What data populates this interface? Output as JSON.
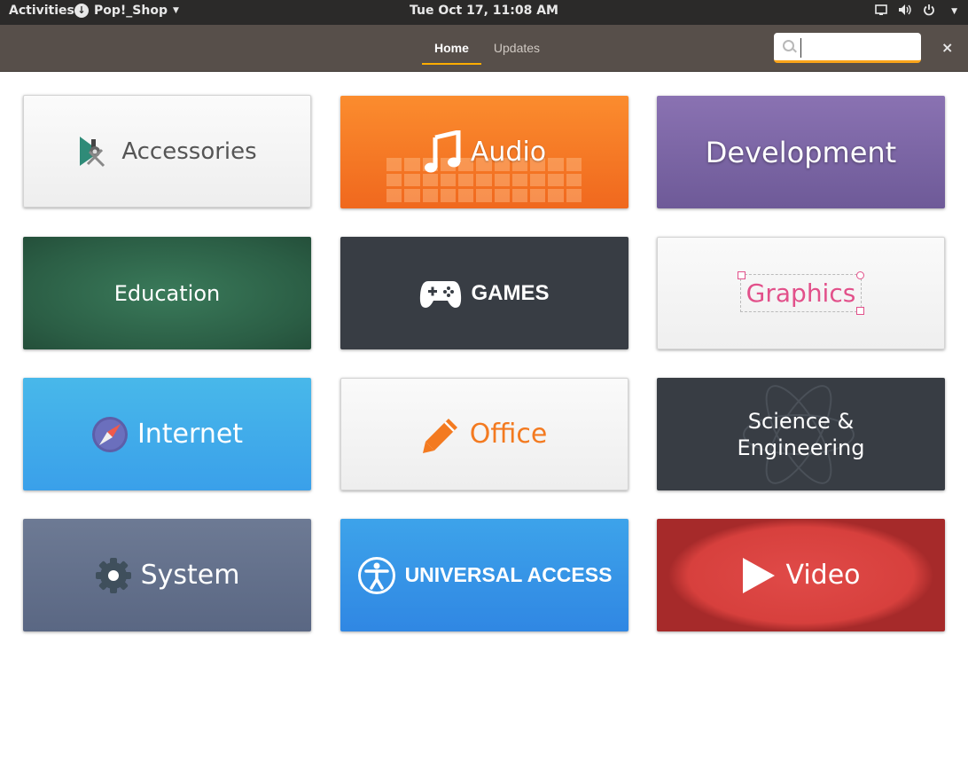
{
  "topbar": {
    "activities": "Activities",
    "app_name": "Pop!_Shop",
    "clock": "Tue Oct 17, 11:08 AM"
  },
  "header": {
    "tabs": [
      {
        "label": "Home",
        "active": true
      },
      {
        "label": "Updates",
        "active": false
      }
    ],
    "search": {
      "value": "",
      "placeholder": ""
    },
    "close": "×"
  },
  "categories": [
    {
      "label": "Accessories",
      "icon": "accessories-icon"
    },
    {
      "label": "Audio",
      "icon": "music-note-icon"
    },
    {
      "label": "Development",
      "icon": ""
    },
    {
      "label": "Education",
      "icon": ""
    },
    {
      "label": "GAMES",
      "icon": "gamepad-icon"
    },
    {
      "label": "Graphics",
      "icon": "selection-box-icon"
    },
    {
      "label": "Internet",
      "icon": "compass-icon"
    },
    {
      "label": "Office",
      "icon": "pencil-icon"
    },
    {
      "label": "Science &",
      "label2": "Engineering",
      "icon": "atom-icon"
    },
    {
      "label": "System",
      "icon": "gear-icon"
    },
    {
      "label": "UNIVERSAL ACCESS",
      "icon": "accessibility-icon"
    },
    {
      "label": "Video",
      "icon": "play-icon"
    }
  ],
  "colors": {
    "accent": "#faa41a",
    "headerbar": "#574f4a",
    "topbar": "#2b2a29"
  }
}
